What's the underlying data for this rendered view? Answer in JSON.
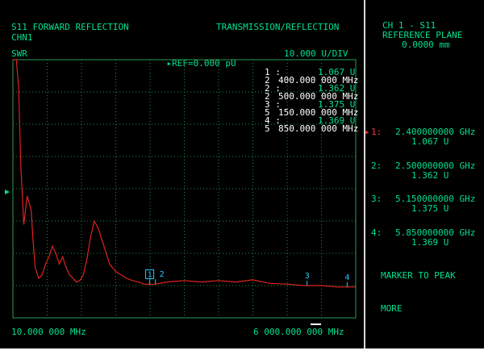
{
  "header": {
    "title_left": "S11 FORWARD REFLECTION",
    "title_right": "TRANSMISSION/REFLECTION",
    "channel": "CHN1",
    "format": "SWR",
    "ref": "REF=0.000 pU",
    "scale": "10.000 U/DIV"
  },
  "footer": {
    "start": "10.000 000 MHz",
    "stop": "6 000.000 000 MHz"
  },
  "marker_table": [
    {
      "id": "1 :",
      "sub": "2",
      "value": "1.067 U",
      "freq": "400.000 000 MHz"
    },
    {
      "id": "2 :",
      "sub": "2",
      "value": "1.362 U",
      "freq": "500.000 000 MHz"
    },
    {
      "id": "3 :",
      "sub": "5",
      "value": "1.375 U",
      "freq": "150.000 000 MHz"
    },
    {
      "id": "4 :",
      "sub": "5",
      "value": "1.369 U",
      "freq": "850.000 000 MHz"
    }
  ],
  "softkeys": {
    "title": "CH 1 - S11",
    "subtitle": "REFERENCE PLANE",
    "plane_value": "0.0000 mm",
    "markers": [
      {
        "label": "1:",
        "freq": "2.400000000 GHz",
        "value": "1.067 U",
        "active": true
      },
      {
        "label": "2:",
        "freq": "2.500000000 GHz",
        "value": "1.362 U",
        "active": false
      },
      {
        "label": "3:",
        "freq": "5.150000000 GHz",
        "value": "1.375 U",
        "active": false
      },
      {
        "label": "4:",
        "freq": "5.850000000 GHz",
        "value": "1.369 U",
        "active": false
      }
    ],
    "marker_to_peak": "MARKER TO PEAK",
    "more": "MORE"
  },
  "colors": {
    "trace": "#e0221f",
    "text": "#00e08c",
    "grid": "#1f8f4a",
    "marker": "#24c8ff"
  },
  "chart_data": {
    "type": "line",
    "x_unit": "MHz",
    "xlim": [
      10,
      6000
    ],
    "grid": true,
    "series": [
      {
        "x": [
          10,
          70,
          110,
          150,
          200,
          260,
          330,
          360,
          400,
          460,
          520,
          580,
          640,
          700,
          760,
          820,
          880,
          940,
          1000,
          1060,
          1120,
          1180,
          1240,
          1300,
          1360,
          1430,
          1500,
          1600,
          1700,
          1800,
          1900,
          2000,
          2100,
          2200,
          2300,
          2400,
          2500,
          2700,
          3000,
          3300,
          3600,
          3900,
          4200,
          4500,
          4800,
          5100,
          5400,
          5700,
          6000
        ],
        "y": [
          4.2,
          4.2,
          3.8,
          2.7,
          1.9,
          2.3,
          2.1,
          1.7,
          1.3,
          1.15,
          1.2,
          1.35,
          1.45,
          1.6,
          1.5,
          1.35,
          1.45,
          1.3,
          1.2,
          1.15,
          1.1,
          1.12,
          1.2,
          1.4,
          1.7,
          1.95,
          1.85,
          1.6,
          1.35,
          1.25,
          1.2,
          1.15,
          1.12,
          1.1,
          1.07,
          1.067,
          1.07,
          1.1,
          1.12,
          1.1,
          1.12,
          1.1,
          1.13,
          1.08,
          1.07,
          1.05,
          1.05,
          1.03,
          1.03
        ]
      }
    ],
    "markers": [
      {
        "label": "1",
        "x": 2400,
        "y": 1.067
      },
      {
        "label": "2",
        "x": 2500,
        "y": 1.362
      },
      {
        "label": "3",
        "x": 5150,
        "y": 1.375
      },
      {
        "label": "4",
        "x": 5850,
        "y": 1.369
      }
    ]
  }
}
